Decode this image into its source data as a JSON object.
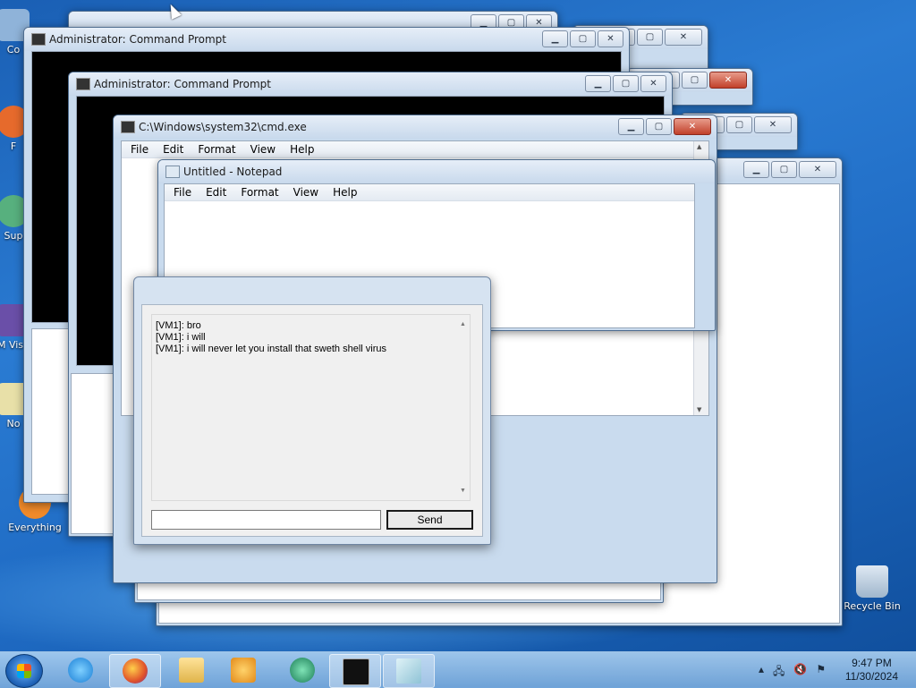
{
  "desktop_icons": [
    {
      "label": "Co"
    },
    {
      "label": "F"
    },
    {
      "label": "Sup"
    },
    {
      "label": "M Visu"
    },
    {
      "label": "No"
    },
    {
      "label": "Everything"
    },
    {
      "label": "Recycle Bin"
    }
  ],
  "windows": {
    "cmd_admin_1": {
      "title": "Administrator:  Command Prompt"
    },
    "cmd_admin_2": {
      "title": "Administrator:  Command Prompt"
    },
    "cmd_exe": {
      "title": "C:\\Windows\\system32\\cmd.exe"
    },
    "notepad": {
      "title": "Untitled - Notepad"
    }
  },
  "menu": {
    "file": "File",
    "edit": "Edit",
    "format": "Format",
    "view": "View",
    "help": "Help"
  },
  "chat": {
    "messages": [
      "[VM1]: bro",
      "[VM1]: i will",
      "[VM1]: i will never let you install that sweth shell virus"
    ],
    "input_value": "",
    "send_label": "Send"
  },
  "taskbar": {
    "apps": [
      {
        "name": "internet-explorer-icon"
      },
      {
        "name": "firefox-icon"
      },
      {
        "name": "file-explorer-icon"
      },
      {
        "name": "media-player-icon"
      },
      {
        "name": "edge-icon"
      },
      {
        "name": "command-prompt-icon"
      },
      {
        "name": "notepad-icon"
      }
    ],
    "time": "9:47 PM",
    "date": "11/30/2024"
  }
}
